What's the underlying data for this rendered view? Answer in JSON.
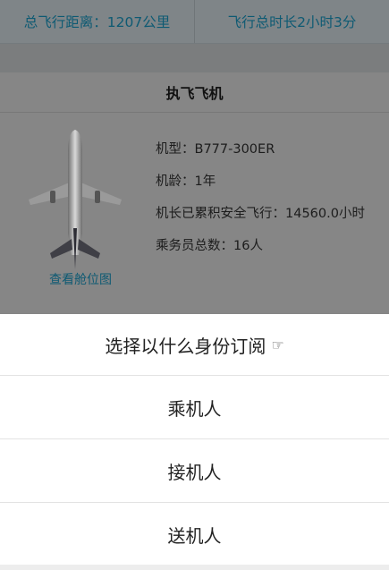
{
  "stats": {
    "distance": "总飞行距离：1207公里",
    "duration": "飞行总时长2小时3分"
  },
  "aircraft": {
    "section_title": "执飞飞机",
    "image_icon": "airplane-icon",
    "seat_map_link": "查看舱位图",
    "model": "机型：B777-300ER",
    "age": "机龄：1年",
    "captain_hours": "机长已累积安全飞行：14560.0小时",
    "crew_count": "乘务员总数：16人"
  },
  "sheet": {
    "title": "选择以什么身份订阅",
    "title_icon": "pointing-hand-icon",
    "options": [
      "乘机人",
      "接机人",
      "送机人"
    ]
  }
}
